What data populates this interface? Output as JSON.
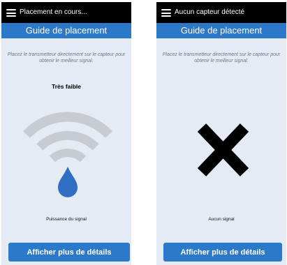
{
  "screens": [
    {
      "topbar_title": "Placement en cours...",
      "header_title": "Guide de placement",
      "instruction": "Placez le transmetteur directement sur le capteur pour obtenir le meilleur signal.",
      "signal_strength": "Très faible",
      "signal_caption": "Puissance du signal",
      "details_button": "Afficher plus de détails",
      "icons": [
        "menu-icon",
        "wifi-signal-icon",
        "water-drop-icon"
      ]
    },
    {
      "topbar_title": "Aucun capteur détecté",
      "header_title": "Guide de placement",
      "instruction": "Placez le transmetteur directement sur le capteur pour obtenir le meilleur signal.",
      "signal_caption": "Aucun signal",
      "details_button": "Afficher plus de détails",
      "icons": [
        "menu-icon",
        "no-signal-x-icon"
      ]
    }
  ],
  "colors": {
    "accent": "#2c78c9",
    "screen_background": "#e4ebf4",
    "topbar": "#000000",
    "signal_arcs": "#c8ccd2",
    "drop": "#2f6fc4"
  }
}
